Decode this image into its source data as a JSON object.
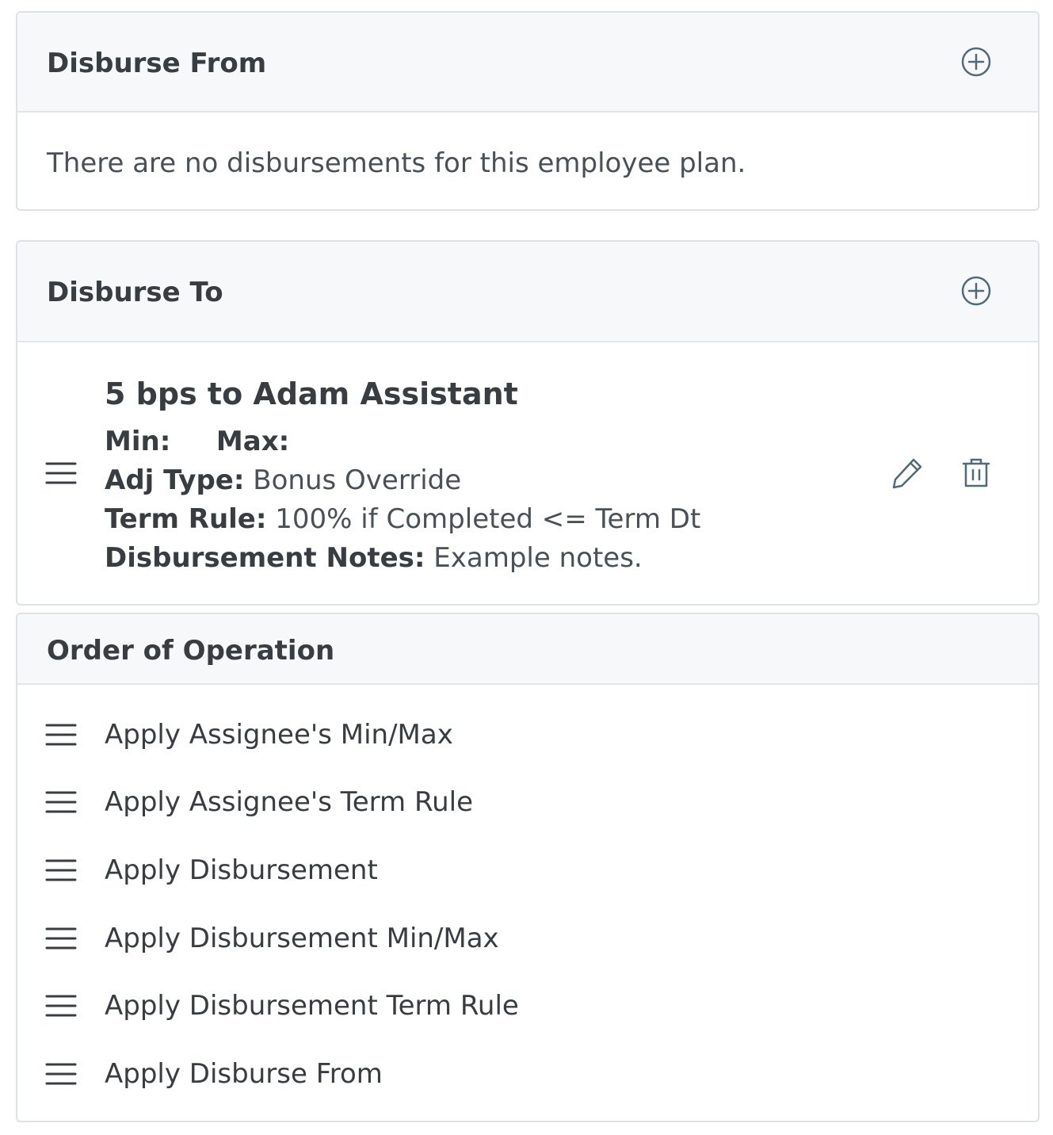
{
  "disburse_from": {
    "title": "Disburse From",
    "empty_message": "There are no disbursements for this employee plan.",
    "add_icon": "plus-circle-icon"
  },
  "disburse_to": {
    "title": "Disburse To",
    "add_icon": "plus-circle-icon",
    "item": {
      "title": "5 bps to Adam Assistant",
      "min_label": "Min:",
      "min_value": "",
      "max_label": "Max:",
      "max_value": "",
      "adj_type_label": "Adj Type:",
      "adj_type_value": "Bonus Override",
      "term_rule_label": "Term Rule:",
      "term_rule_value": "100% if Completed <= Term Dt",
      "notes_label": "Disbursement Notes:",
      "notes_value": "Example notes.",
      "edit_icon": "pencil-icon",
      "delete_icon": "trash-icon",
      "drag_icon": "drag-handle-icon"
    }
  },
  "order_of_operation": {
    "title": "Order of Operation",
    "items": [
      {
        "label": "Apply Assignee's Min/Max"
      },
      {
        "label": "Apply Assignee's Term Rule"
      },
      {
        "label": "Apply Disbursement"
      },
      {
        "label": "Apply Disbursement Min/Max"
      },
      {
        "label": "Apply Disbursement Term Rule"
      },
      {
        "label": "Apply Disburse From"
      }
    ]
  },
  "colors": {
    "header_bg": "#f7f8f9",
    "border": "#dee2e6",
    "icon": "#4e6b78",
    "text": "#383d42"
  }
}
